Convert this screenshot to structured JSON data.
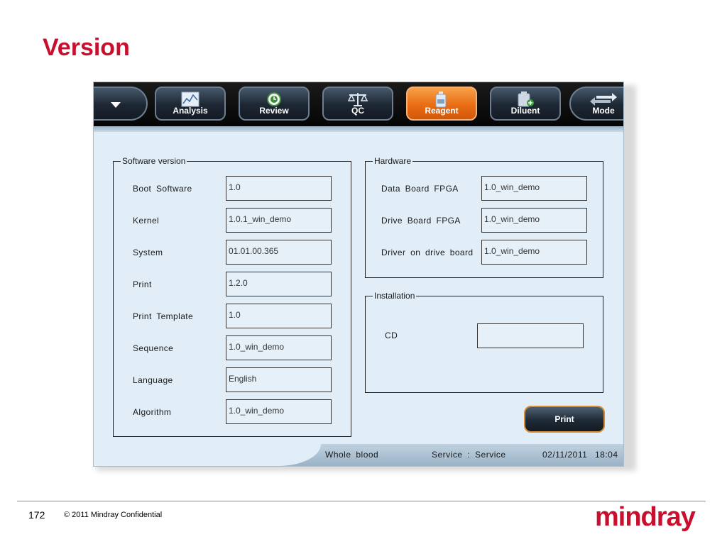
{
  "slide": {
    "title": "Version",
    "page_number": "172",
    "copyright": "© 2011 Mindray Confidential",
    "logo_text": "mindray"
  },
  "colors": {
    "slide_accent": "#c8102e",
    "active_tab": "#e96d13",
    "panel_background": "#e1eef8",
    "toolbar": "#0b0b0b"
  },
  "toolbar": {
    "menu_icon": "caret-down-icon",
    "buttons": [
      {
        "label": "Analysis",
        "icon": "chart-icon"
      },
      {
        "label": "Review",
        "icon": "clock-icon"
      },
      {
        "label": "QC",
        "icon": "scale-icon"
      },
      {
        "label": "Reagent",
        "icon": "bottle-icon",
        "active": true
      },
      {
        "label": "Diluent",
        "icon": "container-plus-icon"
      },
      {
        "label": "Mode",
        "icon": "arrows-icon"
      }
    ]
  },
  "software": {
    "legend": "Software version",
    "rows": [
      {
        "label": "Boot Software",
        "value": "1.0"
      },
      {
        "label": "Kernel",
        "value": "1.0.1_win_demo"
      },
      {
        "label": "System",
        "value": "01.01.00.365"
      },
      {
        "label": "Print",
        "value": "1.2.0"
      },
      {
        "label": "Print Template",
        "value": "1.0"
      },
      {
        "label": "Sequence",
        "value": "1.0_win_demo"
      },
      {
        "label": "Language",
        "value": "English"
      },
      {
        "label": "Algorithm",
        "value": "1.0_win_demo"
      }
    ]
  },
  "hardware": {
    "legend": "Hardware",
    "rows": [
      {
        "label": "Data Board FPGA",
        "value": "1.0_win_demo"
      },
      {
        "label": "Drive Board FPGA",
        "value": "1.0_win_demo"
      },
      {
        "label": "Driver on drive board",
        "value": "1.0_win_demo"
      }
    ]
  },
  "installation": {
    "legend": "Installation",
    "rows": [
      {
        "label": "CD",
        "value": ""
      }
    ]
  },
  "print_button": "Print",
  "status": {
    "mode": "Whole blood",
    "user": "Service : Service",
    "date": "02/11/2011",
    "time": "18:04"
  }
}
